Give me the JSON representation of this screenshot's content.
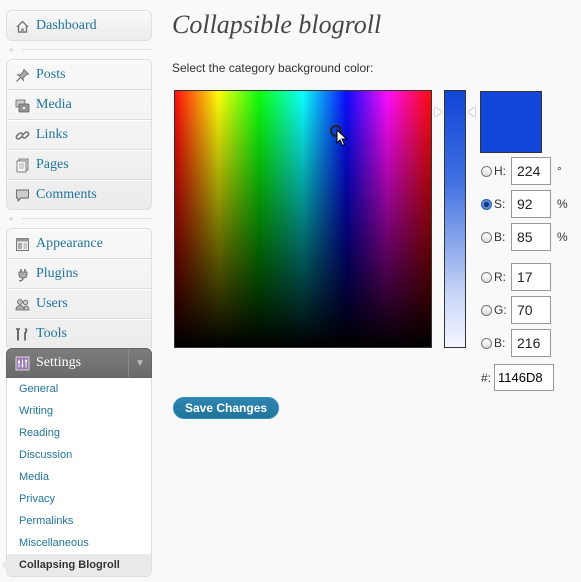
{
  "sidebar": {
    "group1": [
      {
        "label": "Dashboard",
        "icon": "dashboard-icon"
      }
    ],
    "group2": [
      {
        "label": "Posts",
        "icon": "pin-icon"
      },
      {
        "label": "Media",
        "icon": "camera-icon"
      },
      {
        "label": "Links",
        "icon": "chain-link-icon"
      },
      {
        "label": "Pages",
        "icon": "pages-icon"
      },
      {
        "label": "Comments",
        "icon": "speech-bubble-icon"
      }
    ],
    "group3": [
      {
        "label": "Appearance",
        "icon": "layout-icon"
      },
      {
        "label": "Plugins",
        "icon": "plug-icon"
      },
      {
        "label": "Users",
        "icon": "users-icon"
      },
      {
        "label": "Tools",
        "icon": "tools-icon"
      }
    ],
    "settings": {
      "label": "Settings",
      "icon": "settings-icon",
      "sub_items": [
        "General",
        "Writing",
        "Reading",
        "Discussion",
        "Media",
        "Privacy",
        "Permalinks",
        "Miscellaneous",
        "Collapsing Blogroll"
      ],
      "current": "Collapsing Blogroll"
    }
  },
  "main": {
    "title": "Collapsible blogroll",
    "prompt": "Select the category background color:",
    "save_label": "Save Changes"
  },
  "picker": {
    "selected_color": "#1146D8",
    "h": {
      "letter": "H:",
      "value": "224",
      "unit": "°",
      "checked": false
    },
    "s": {
      "letter": "S:",
      "value": "92",
      "unit": "%",
      "checked": true
    },
    "b": {
      "letter": "B:",
      "value": "85",
      "unit": "%",
      "checked": false
    },
    "r": {
      "letter": "R:",
      "value": "17",
      "checked": false
    },
    "g": {
      "letter": "G:",
      "value": "70",
      "checked": false
    },
    "b2": {
      "letter": "B:",
      "value": "216",
      "checked": false
    },
    "hex_label": "#:",
    "hex_value": "1146D8"
  }
}
